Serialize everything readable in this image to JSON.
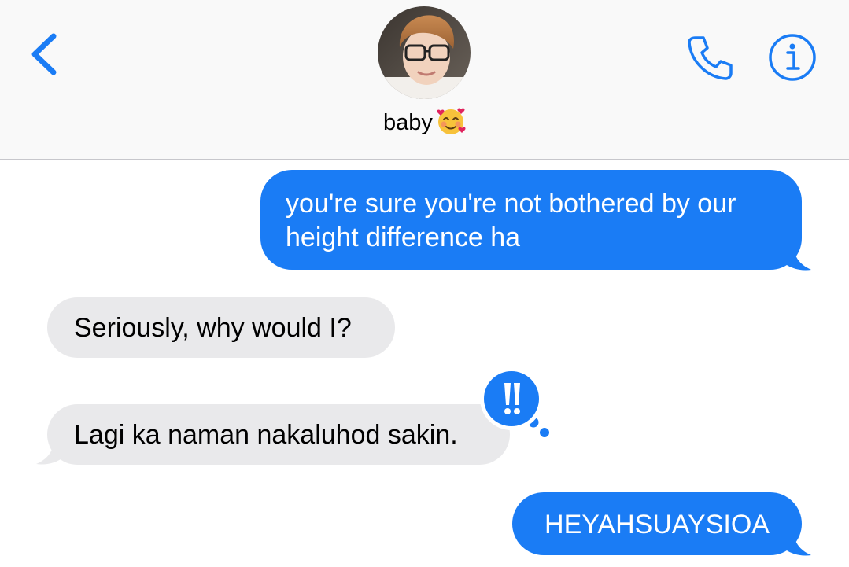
{
  "header": {
    "contact_name": "baby",
    "contact_emoji": "smiling-face-with-hearts",
    "icons": {
      "back": "chevron-left-icon",
      "call": "phone-icon",
      "info": "info-icon"
    }
  },
  "colors": {
    "accent": "#1a7cf5",
    "received_bubble": "#e9e9eb",
    "header_bg": "#f9f9f9"
  },
  "messages": [
    {
      "direction": "sent",
      "text": "you're sure you're not bothered by our height difference ha"
    },
    {
      "direction": "received",
      "text": "Seriously, why would I?"
    },
    {
      "direction": "received",
      "text": "Lagi ka naman nakaluhod sakin.",
      "tapback": "!!"
    },
    {
      "direction": "sent",
      "text": "HEYAHSUAYSIOA"
    }
  ]
}
